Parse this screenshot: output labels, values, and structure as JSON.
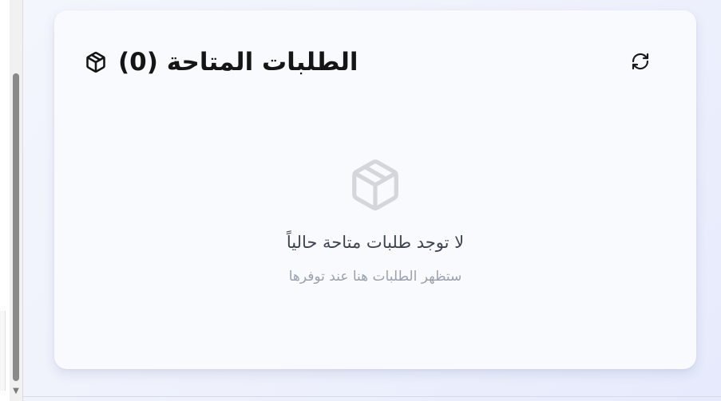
{
  "card": {
    "title": "الطلبات المتاحة (0)",
    "refresh_icon": "refresh-icon",
    "title_icon": "package-icon"
  },
  "empty_state": {
    "icon": "package-icon",
    "title": "لا توجد طلبات متاحة حالياً",
    "subtitle": "ستظهر الطلبات هنا عند توفرها"
  },
  "colors": {
    "background": "#eef1fc",
    "card": "#f9fafe",
    "title": "#151515",
    "empty_title": "#3d4350",
    "empty_subtitle": "#9aa0ac",
    "empty_icon": "#d4d6dc",
    "scroll_thumb": "#8a8a8a"
  }
}
